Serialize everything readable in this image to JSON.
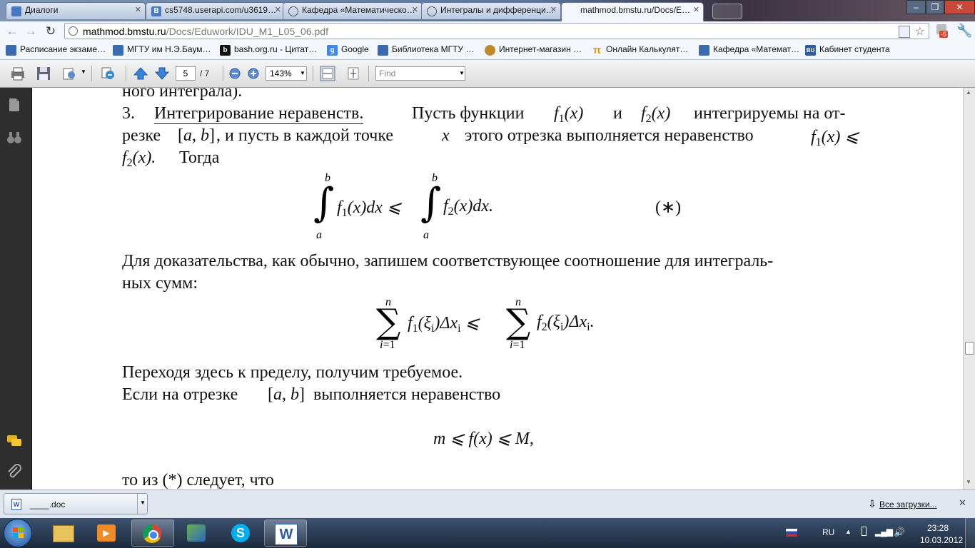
{
  "tabs": [
    {
      "title": "Диалоги",
      "icon": "chat-icon"
    },
    {
      "title": "cs5748.userapi.com/u3619…",
      "icon": "vk-icon"
    },
    {
      "title": "Кафедра «Математическо…",
      "icon": "globe-icon"
    },
    {
      "title": "Интегралы и дифференци…",
      "icon": "globe-icon"
    },
    {
      "title": "mathmod.bmstu.ru/Docs/E…",
      "icon": "pdf-icon",
      "active": true
    }
  ],
  "address": {
    "host": "mathmod.bmstu.ru",
    "path": "/Docs/Eduwork/IDU_M1_L05_06.pdf"
  },
  "extension_badge": "-5",
  "bookmarks": [
    {
      "label": "Расписание экзаме…",
      "color": "#3a6ab0",
      "glyph": ""
    },
    {
      "label": "МГТУ им Н.Э.Баум…",
      "color": "#3a6ab0",
      "glyph": ""
    },
    {
      "label": "bash.org.ru - Цитат…",
      "color": "#111111",
      "glyph": "b"
    },
    {
      "label": "Google",
      "color": "#4285f4",
      "glyph": "g"
    },
    {
      "label": "Библиотека МГТУ …",
      "color": "#3a6ab0",
      "glyph": ""
    },
    {
      "label": "Интернет-магазин …",
      "color": "#c08a2a",
      "glyph": ""
    },
    {
      "label": "Онлайн Калькулят…",
      "color": "#e0a020",
      "glyph": "π"
    },
    {
      "label": "Кафедра «Математ…",
      "color": "#3a6ab0",
      "glyph": ""
    },
    {
      "label": "Кабинет студента",
      "color": "#2a5aa0",
      "glyph": "BU"
    }
  ],
  "pdf": {
    "page": "5",
    "total": "/ 7",
    "zoom": "143%",
    "find_placeholder": "Find"
  },
  "content": {
    "l0": "ного интеграла).",
    "item_no": "3.",
    "item_title": "Интегрирование неравенств.",
    "l1_a": "Пусть функции",
    "l1_b": "и",
    "l1_c": "интегрируемы на от-",
    "l2_a": "резке",
    "l2_b": ", и пусть в каждой точке",
    "l2_c": "этого отрезка выполняется неравенство",
    "l3": "Тогда",
    "eq_tag": "(∗)",
    "p2a": "Для доказательства, как обычно, запишем соответствующее соотношение для интеграль-",
    "p2b": "ных сумм:",
    "p3": "Переходя здесь к пределу, получим требуемое.",
    "p4_a": "Если на отрезке",
    "p4_b": "выполняется неравенство",
    "p5": "то из (*) следует, что"
  },
  "download": {
    "file": "____.doc",
    "all_label": "Все загрузки..."
  },
  "tray": {
    "lang": "RU",
    "time": "23:28",
    "date": "10.03.2012"
  }
}
